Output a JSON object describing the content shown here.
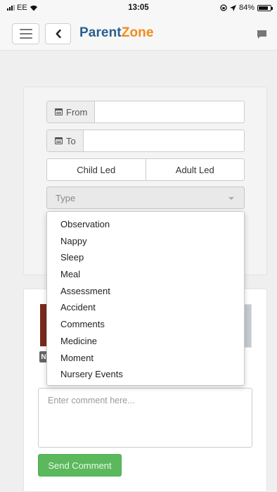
{
  "status_bar": {
    "carrier": "EE",
    "time": "13:05",
    "battery": "84%",
    "battery_level": 0.84
  },
  "navbar": {
    "logo_part1": "Parent",
    "logo_part2": "Zone"
  },
  "filters": {
    "from_label": "From",
    "to_label": "To",
    "toggle": [
      "Child Led",
      "Adult Led"
    ],
    "type_placeholder": "Type"
  },
  "dropdown": {
    "options": [
      "Observation",
      "Nappy",
      "Sleep",
      "Meal",
      "Assessment",
      "Accident",
      "Comments",
      "Medicine",
      "Moment",
      "Nursery Events"
    ]
  },
  "comment": {
    "badge": "N",
    "placeholder": "Enter comment here...",
    "send_label": "Send Comment"
  }
}
